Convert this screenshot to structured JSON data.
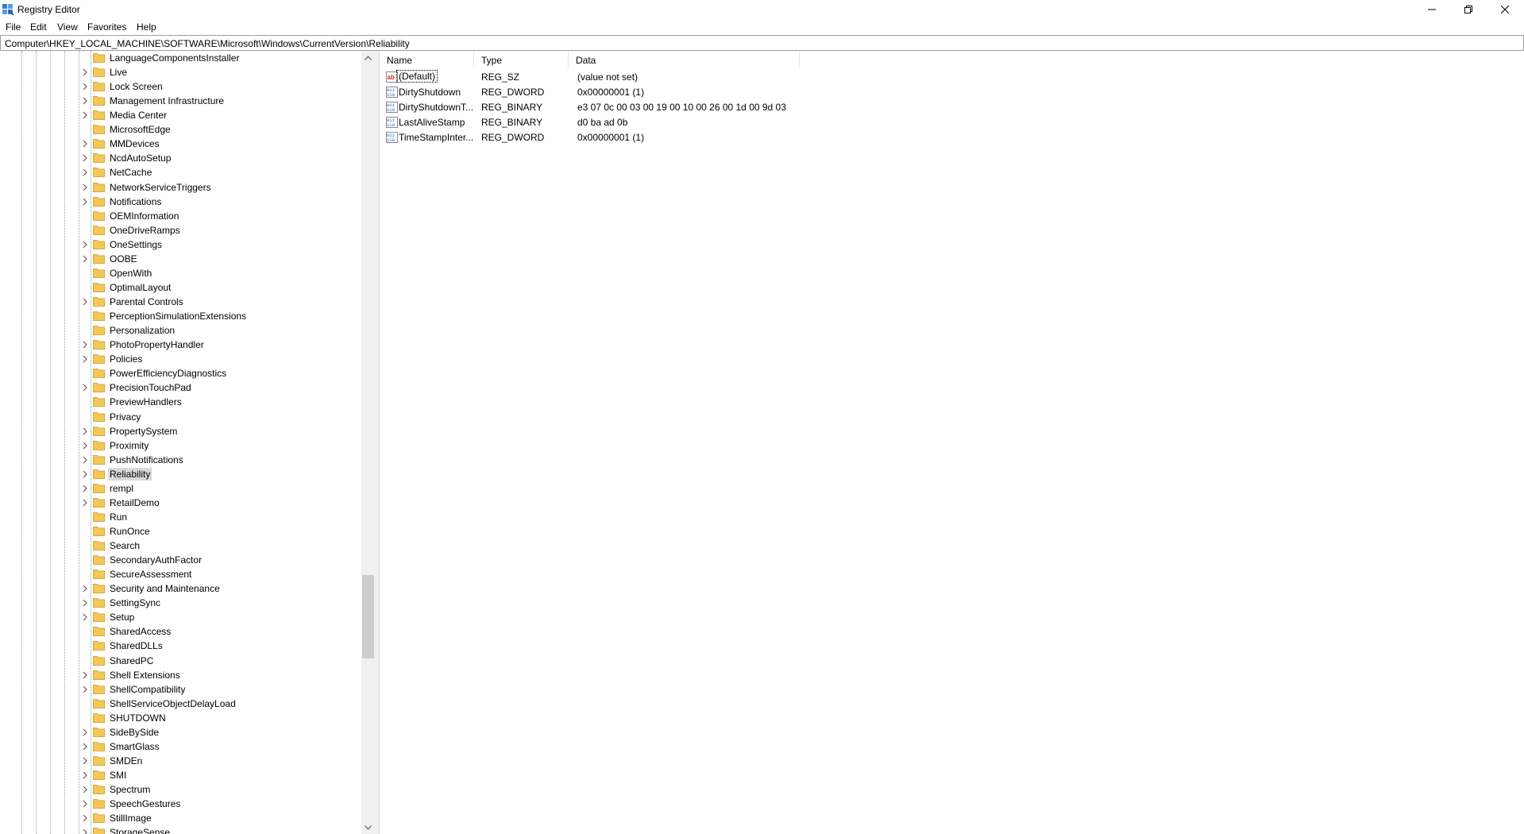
{
  "window": {
    "title": "Registry Editor",
    "controls": [
      "minimize",
      "restore",
      "close"
    ]
  },
  "menubar": {
    "items": [
      "File",
      "Edit",
      "View",
      "Favorites",
      "Help"
    ]
  },
  "address": {
    "path": "Computer\\HKEY_LOCAL_MACHINE\\SOFTWARE\\Microsoft\\Windows\\CurrentVersion\\Reliability"
  },
  "tree": {
    "selected": "Reliability",
    "items": [
      {
        "label": "LanguageComponentsInstaller",
        "expandable": false
      },
      {
        "label": "Live",
        "expandable": true
      },
      {
        "label": "Lock Screen",
        "expandable": true
      },
      {
        "label": "Management Infrastructure",
        "expandable": true
      },
      {
        "label": "Media Center",
        "expandable": true
      },
      {
        "label": "MicrosoftEdge",
        "expandable": false
      },
      {
        "label": "MMDevices",
        "expandable": true
      },
      {
        "label": "NcdAutoSetup",
        "expandable": true
      },
      {
        "label": "NetCache",
        "expandable": true
      },
      {
        "label": "NetworkServiceTriggers",
        "expandable": true
      },
      {
        "label": "Notifications",
        "expandable": true
      },
      {
        "label": "OEMInformation",
        "expandable": false
      },
      {
        "label": "OneDriveRamps",
        "expandable": false
      },
      {
        "label": "OneSettings",
        "expandable": true
      },
      {
        "label": "OOBE",
        "expandable": true
      },
      {
        "label": "OpenWith",
        "expandable": false
      },
      {
        "label": "OptimalLayout",
        "expandable": false
      },
      {
        "label": "Parental Controls",
        "expandable": true
      },
      {
        "label": "PerceptionSimulationExtensions",
        "expandable": false
      },
      {
        "label": "Personalization",
        "expandable": false
      },
      {
        "label": "PhotoPropertyHandler",
        "expandable": true
      },
      {
        "label": "Policies",
        "expandable": true
      },
      {
        "label": "PowerEfficiencyDiagnostics",
        "expandable": false
      },
      {
        "label": "PrecisionTouchPad",
        "expandable": true
      },
      {
        "label": "PreviewHandlers",
        "expandable": false
      },
      {
        "label": "Privacy",
        "expandable": false
      },
      {
        "label": "PropertySystem",
        "expandable": true
      },
      {
        "label": "Proximity",
        "expandable": true
      },
      {
        "label": "PushNotifications",
        "expandable": true
      },
      {
        "label": "Reliability",
        "expandable": true
      },
      {
        "label": "rempl",
        "expandable": true
      },
      {
        "label": "RetailDemo",
        "expandable": true
      },
      {
        "label": "Run",
        "expandable": false
      },
      {
        "label": "RunOnce",
        "expandable": false
      },
      {
        "label": "Search",
        "expandable": false
      },
      {
        "label": "SecondaryAuthFactor",
        "expandable": false
      },
      {
        "label": "SecureAssessment",
        "expandable": false
      },
      {
        "label": "Security and Maintenance",
        "expandable": true
      },
      {
        "label": "SettingSync",
        "expandable": true
      },
      {
        "label": "Setup",
        "expandable": true
      },
      {
        "label": "SharedAccess",
        "expandable": false
      },
      {
        "label": "SharedDLLs",
        "expandable": false
      },
      {
        "label": "SharedPC",
        "expandable": false
      },
      {
        "label": "Shell Extensions",
        "expandable": true
      },
      {
        "label": "ShellCompatibility",
        "expandable": true
      },
      {
        "label": "ShellServiceObjectDelayLoad",
        "expandable": false
      },
      {
        "label": "SHUTDOWN",
        "expandable": false
      },
      {
        "label": "SideBySide",
        "expandable": true
      },
      {
        "label": "SmartGlass",
        "expandable": true
      },
      {
        "label": "SMDEn",
        "expandable": true
      },
      {
        "label": "SMI",
        "expandable": true
      },
      {
        "label": "Spectrum",
        "expandable": true
      },
      {
        "label": "SpeechGestures",
        "expandable": true
      },
      {
        "label": "StillImage",
        "expandable": true
      },
      {
        "label": "StorageSense",
        "expandable": true
      }
    ]
  },
  "list": {
    "columns": [
      "Name",
      "Type",
      "Data"
    ],
    "rows": [
      {
        "name": "(Default)",
        "type": "REG_SZ",
        "data": "(value not set)",
        "icon": "string-value-icon"
      },
      {
        "name": "DirtyShutdown",
        "type": "REG_DWORD",
        "data": "0x00000001 (1)",
        "icon": "binary-value-icon"
      },
      {
        "name": "DirtyShutdownT...",
        "type": "REG_BINARY",
        "data": "e3 07 0c 00 03 00 19 00 10 00 26 00 1d 00 9d 03",
        "icon": "binary-value-icon"
      },
      {
        "name": "LastAliveStamp",
        "type": "REG_BINARY",
        "data": "d0 ba ad 0b",
        "icon": "binary-value-icon"
      },
      {
        "name": "TimeStampInter...",
        "type": "REG_DWORD",
        "data": "0x00000001 (1)",
        "icon": "binary-value-icon"
      }
    ]
  },
  "colors": {
    "folder": "#f0c95a",
    "folder_edge": "#d9a93a",
    "selection": "#d9d9d9",
    "string_icon": "#c42b1c",
    "binary_icon": "#1e5aa8"
  }
}
